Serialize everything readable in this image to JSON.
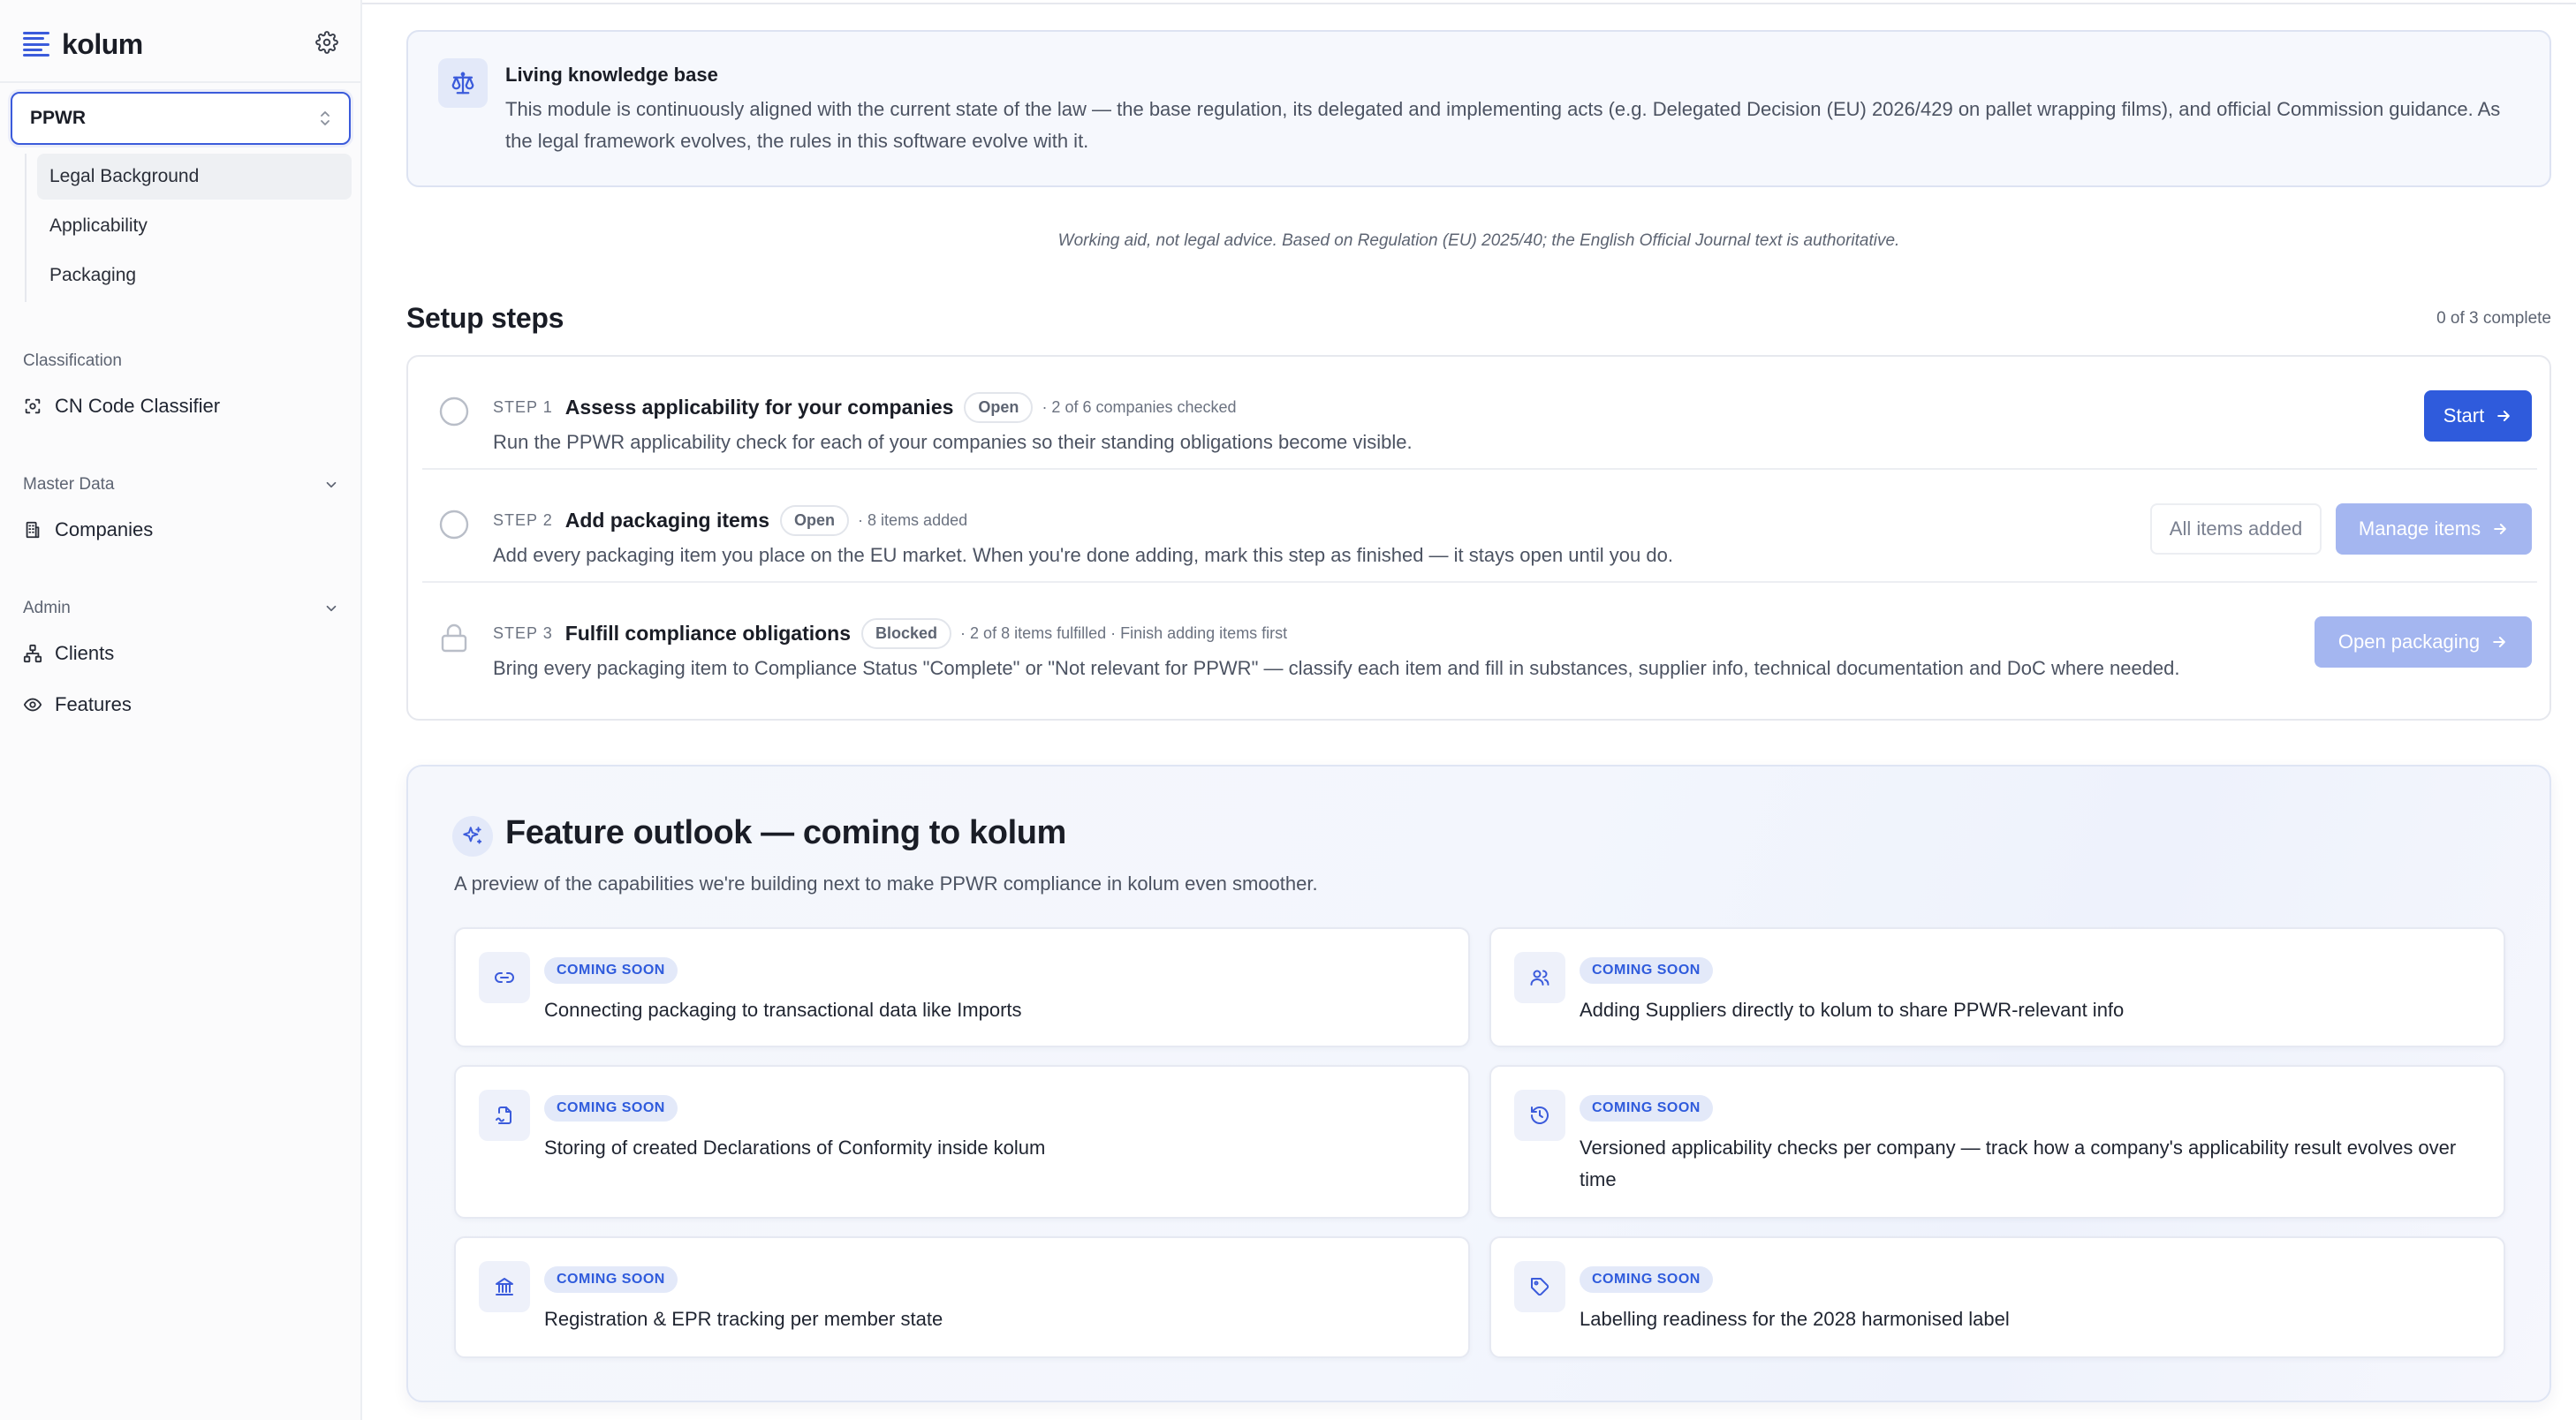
{
  "app": {
    "brand": "kolum"
  },
  "sidebar": {
    "module": "PPWR",
    "subnav": [
      {
        "label": "Legal Background",
        "active": true
      },
      {
        "label": "Applicability",
        "active": false
      },
      {
        "label": "Packaging",
        "active": false
      }
    ],
    "classification": {
      "title": "Classification",
      "items": [
        {
          "label": "CN Code Classifier",
          "icon": "scan-icon"
        }
      ]
    },
    "master_data": {
      "title": "Master Data",
      "items": [
        {
          "label": "Companies",
          "icon": "building-icon"
        }
      ]
    },
    "admin": {
      "title": "Admin",
      "items": [
        {
          "label": "Clients",
          "icon": "org-icon"
        },
        {
          "label": "Features",
          "icon": "eye-icon"
        }
      ]
    }
  },
  "knowledge": {
    "title": "Living knowledge base",
    "text": "This module is continuously aligned with the current state of the law — the base regulation, its delegated and implementing acts (e.g. Delegated Decision (EU) 2026/429 on pallet wrapping films), and official Commission guidance. As the legal framework evolves, the rules in this software evolve with it.",
    "icon": "scale-icon"
  },
  "disclaimer": "Working aid, not legal advice. Based on Regulation (EU) 2025/40; the English Official Journal text is authoritative.",
  "setup": {
    "title": "Setup steps",
    "count": "0 of 3 complete",
    "steps": [
      {
        "num": "STEP 1",
        "title": "Assess applicability for your companies",
        "status": "Open",
        "meta": "· 2 of 6 companies checked",
        "desc": "Run the PPWR applicability check for each of your companies so their standing obligations become visible.",
        "primary": "Start"
      },
      {
        "num": "STEP 2",
        "title": "Add packaging items",
        "status": "Open",
        "meta": "· 8 items added",
        "desc": "Add every packaging item you place on the EU market. When you're done adding, mark this step as finished — it stays open until you do.",
        "secondary": "All items added",
        "primary": "Manage items"
      },
      {
        "num": "STEP 3",
        "title": "Fulfill compliance obligations",
        "status": "Blocked",
        "meta": "· 2 of 8 items fulfilled · Finish adding items first",
        "desc": "Bring every packaging item to Compliance Status \"Complete\" or \"Not relevant for PPWR\" — classify each item and fill in substances, supplier info, technical documentation and DoC where needed.",
        "primary": "Open packaging"
      }
    ]
  },
  "outlook": {
    "title": "Feature outlook — coming to kolum",
    "subtitle": "A preview of the capabilities we're building next to make PPWR compliance in kolum even smoother.",
    "badge": "COMING SOON",
    "features": [
      {
        "icon": "link-icon",
        "text": "Connecting packaging to transactional data like Imports"
      },
      {
        "icon": "users-icon",
        "text": "Adding Suppliers directly to kolum to share PPWR-relevant info"
      },
      {
        "icon": "signed-doc-icon",
        "text": "Storing of created Declarations of Conformity inside kolum"
      },
      {
        "icon": "history-icon",
        "text": "Versioned applicability checks per company — track how a company's applicability result evolves over time"
      },
      {
        "icon": "bank-icon",
        "text": "Registration & EPR tracking per member state"
      },
      {
        "icon": "tag-icon",
        "text": "Labelling readiness for the 2028 harmonised label"
      }
    ]
  },
  "colors": {
    "accent": "#2f5bdc",
    "accent_soft": "#a4b6f0",
    "badge_bg": "#e3e9f9"
  }
}
